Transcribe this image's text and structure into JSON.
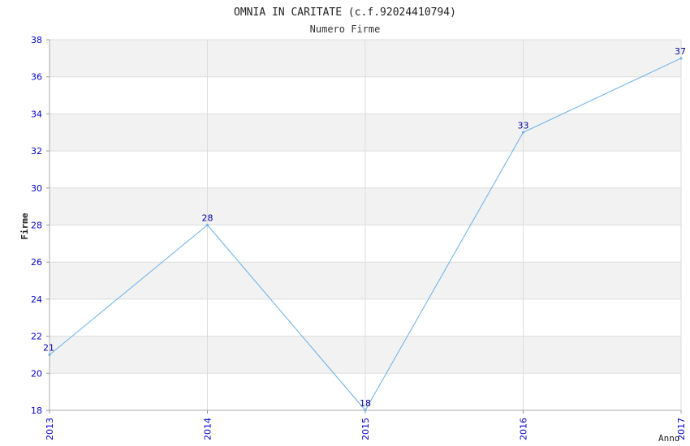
{
  "chart_data": {
    "type": "line",
    "title": "OMNIA IN CARITATE (c.f.92024410794)",
    "subtitle": "Numero Firme",
    "xlabel": "Anno",
    "ylabel": "Firme",
    "x": [
      "2013",
      "2014",
      "2015",
      "2016",
      "2017"
    ],
    "series": [
      {
        "values": [
          21,
          28,
          18,
          33,
          37
        ]
      }
    ],
    "ylim": [
      18,
      38
    ],
    "yticks": [
      "18",
      "20",
      "22",
      "24",
      "26",
      "28",
      "30",
      "32",
      "34",
      "36",
      "38"
    ],
    "grid": true,
    "colors": {
      "line": "#6aaee8",
      "tick_labels": "#0000cc",
      "data_labels": "#000099",
      "band": "#f2f2f2",
      "gridline": "#dddddd"
    }
  }
}
